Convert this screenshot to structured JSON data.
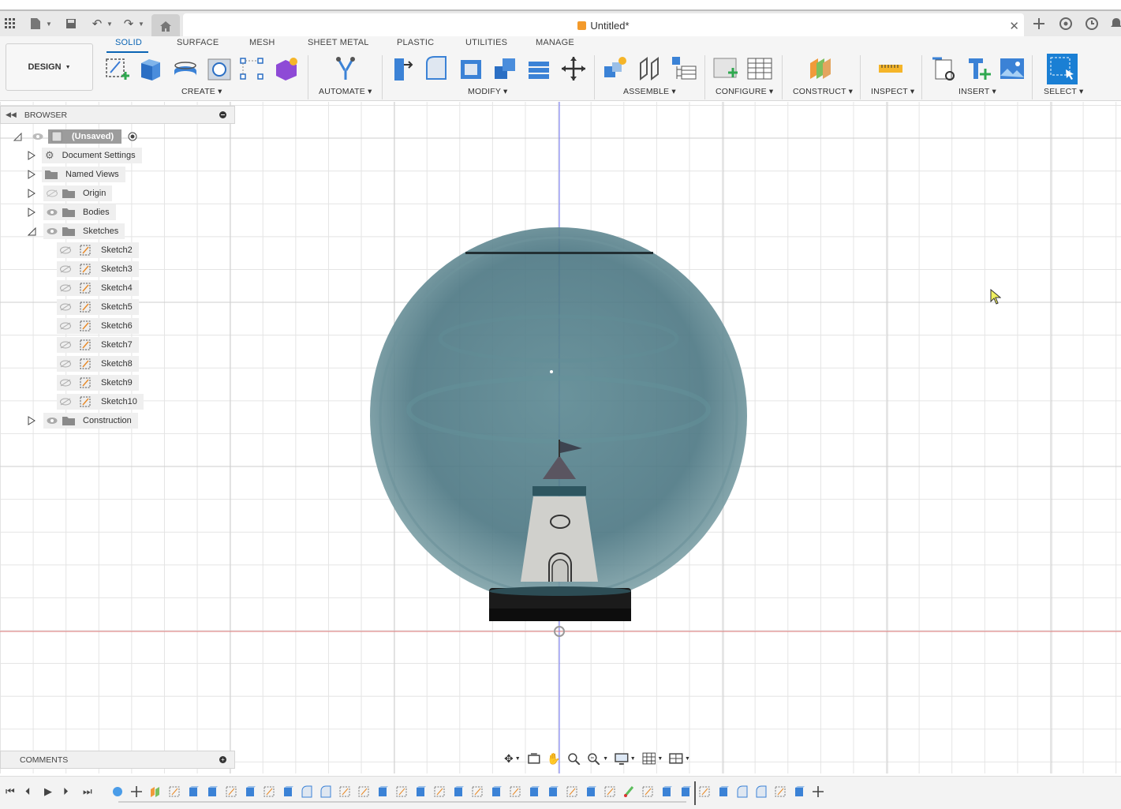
{
  "titlebar": {
    "doc_title": "Untitled*"
  },
  "tabs": [
    {
      "label": "SOLID",
      "active": true
    },
    {
      "label": "SURFACE"
    },
    {
      "label": "MESH"
    },
    {
      "label": "SHEET METAL"
    },
    {
      "label": "PLASTIC"
    },
    {
      "label": "UTILITIES"
    },
    {
      "label": "MANAGE"
    }
  ],
  "workspace": {
    "label": "DESIGN"
  },
  "groups": {
    "create": "CREATE",
    "automate": "AUTOMATE",
    "modify": "MODIFY",
    "assemble": "ASSEMBLE",
    "configure": "CONFIGURE",
    "construct": "CONSTRUCT",
    "inspect": "INSPECT",
    "insert": "INSERT",
    "select": "SELECT"
  },
  "browser": {
    "title": "BROWSER",
    "root": "(Unsaved)",
    "items": [
      {
        "label": "Document Settings"
      },
      {
        "label": "Named Views"
      },
      {
        "label": "Origin"
      },
      {
        "label": "Bodies"
      },
      {
        "label": "Sketches"
      },
      {
        "label": "Construction"
      }
    ],
    "sketches": [
      "Sketch2",
      "Sketch3",
      "Sketch4",
      "Sketch5",
      "Sketch6",
      "Sketch7",
      "Sketch8",
      "Sketch9",
      "Sketch10"
    ]
  },
  "comments": {
    "title": "COMMENTS"
  },
  "colors": {
    "accent": "#0a64b4",
    "sphere": "#4a7480",
    "axis_blue": "#6a6cf0",
    "axis_red": "#e07a7a"
  }
}
